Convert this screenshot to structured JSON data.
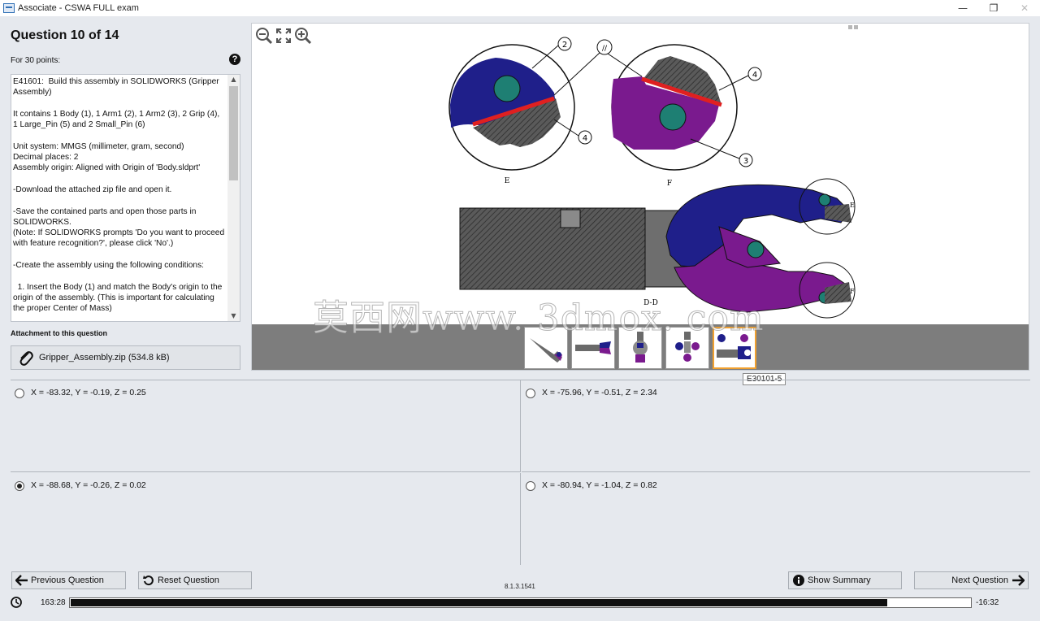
{
  "window": {
    "title": "Associate - CSWA FULL exam",
    "minimize": "—",
    "maximize": "❐",
    "close": "✕"
  },
  "question": {
    "title": "Question 10 of 14",
    "points": "For 30 points:",
    "description": "E41601:  Build this assembly in SOLIDWORKS (Gripper Assembly)\n\nIt contains 1 Body (1), 1 Arm1 (2), 1 Arm2 (3), 2 Grip (4), 1 Large_Pin (5) and 2 Small_Pin (6)\n\nUnit system: MMGS (millimeter, gram, second)\nDecimal places: 2\nAssembly origin: Aligned with Origin of 'Body.sldprt'\n\n-Download the attached zip file and open it.\n\n-Save the contained parts and open those parts in SOLIDWORKS.\n(Note: If SOLIDWORKS prompts 'Do you want to proceed with feature recognition?', please click 'No'.)\n\n-Create the assembly using the following conditions:\n\n  1. Insert the Body (1) and match the Body's origin to the origin of the assembly. (This is important for calculating the proper Center of Mass)",
    "attachment_label": "Attachment to this question",
    "attachment_file": "Gripper_Assembly.zip (534.8 kB)"
  },
  "viewer": {
    "detail_labels": [
      "E",
      "F"
    ],
    "section_label": "D-D",
    "callouts": [
      "2",
      "//",
      "4",
      "4",
      "3"
    ],
    "side_markers": [
      "E",
      "F"
    ],
    "tooltip": "E30101-5",
    "thumbnail_count": 5,
    "selected_thumbnail": 5,
    "watermark": "莫西网www. 3dmox. com"
  },
  "answers": [
    {
      "text": "X = -83.32, Y = -0.19, Z = 0.25",
      "selected": false
    },
    {
      "text": "X = -75.96, Y = -0.51, Z = 2.34",
      "selected": false
    },
    {
      "text": "X = -88.68, Y = -0.26, Z = 0.02",
      "selected": true
    },
    {
      "text": "X = -80.94, Y = -1.04, Z = 0.82",
      "selected": false
    }
  ],
  "footer": {
    "prev_label": "Previous Question",
    "reset_label": "Reset Question",
    "summary_label": "Show Summary",
    "next_label": "Next Question",
    "version": "8.1.3.1541",
    "elapsed": "163:28",
    "remaining": "-16:32",
    "progress_fraction": 0.908
  },
  "colors": {
    "arm_blue": "#1f1f8a",
    "arm_purple": "#7a1a8e",
    "pin_teal": "#1e7f73",
    "grip_hatch": "#555555",
    "accent_red": "#e02020",
    "thumb_selected": "#f0a030"
  }
}
